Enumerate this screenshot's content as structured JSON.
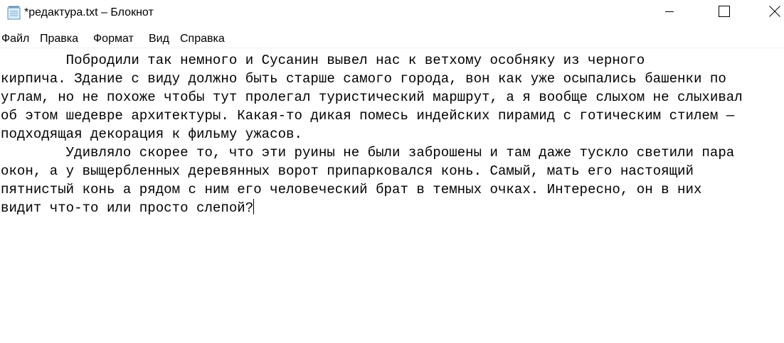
{
  "window": {
    "title": "*редактура.txt – Блокнот",
    "icons": {
      "app": "notepad-icon",
      "minimize": "minimize-icon",
      "maximize": "maximize-icon",
      "close": "close-icon"
    }
  },
  "menubar": {
    "items": [
      {
        "label": "Файл"
      },
      {
        "label": "Правка"
      },
      {
        "label": "Формат"
      },
      {
        "label": "Вид"
      },
      {
        "label": "Справка"
      }
    ]
  },
  "document": {
    "lines": [
      "        Побродили так немного и Сусанин вывел нас к ветхому особняку из черного",
      "кирпича. Здание с виду должно быть старше самого города, вон как уже осыпались башенки по",
      "углам, но не похоже чтобы тут пролегал туристический маршрут, а я вообще слыхом не слыхивал",
      "об этом шедевре архитектуры. Какая-то дикая помесь индейских пирамид с готическим стилем —",
      "подходящая декорация к фильму ужасов.",
      "        Удивляло скорее то, что эти руины не были заброшены и там даже тускло светили пара",
      "окон, а у выщербленных деревянных ворот припарковался конь. Самый, мать его настоящий",
      "пятнистый конь а рядом с ним его человеческий брат в темных очках. Интересно, он в них",
      "видит что-то или просто слепой?"
    ]
  }
}
